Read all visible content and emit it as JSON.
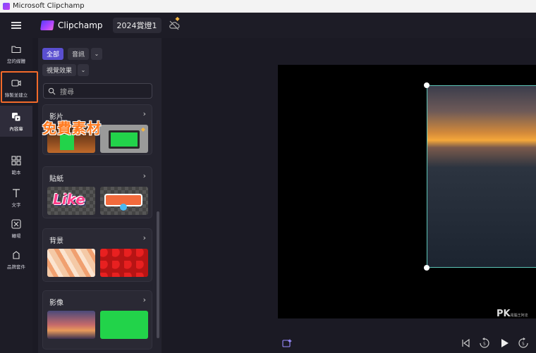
{
  "window": {
    "title": "Microsoft Clipchamp"
  },
  "appbar": {
    "brand": "Clipchamp",
    "project_name": "2024賞燈1"
  },
  "rail": {
    "items": [
      {
        "label": "您的媒體",
        "icon": "folder-icon"
      },
      {
        "label": "錄製並建立",
        "icon": "camera-icon"
      },
      {
        "label": "內容庫",
        "icon": "library-icon"
      },
      {
        "label": "範本",
        "icon": "templates-icon"
      },
      {
        "label": "文字",
        "icon": "text-icon"
      },
      {
        "label": "轉場",
        "icon": "transitions-icon"
      },
      {
        "label": "品牌套件",
        "icon": "brand-kit-icon"
      }
    ]
  },
  "filters": {
    "all": "全部",
    "audio": "音訊",
    "visual": "視覺效果"
  },
  "search": {
    "placeholder": "搜尋"
  },
  "sections": [
    {
      "title": "影片"
    },
    {
      "title": "貼紙"
    },
    {
      "title": "背景"
    },
    {
      "title": "影像"
    }
  ],
  "stickers": {
    "like": "Like"
  },
  "callout": "免費素材",
  "watermark": {
    "main": "PK",
    "sub": "電腦王阿達"
  },
  "colors": {
    "accent": "#5a4fd0",
    "highlight": "#f36a2a",
    "selection": "#5ec6b8",
    "green_screen": "#22d34a"
  }
}
